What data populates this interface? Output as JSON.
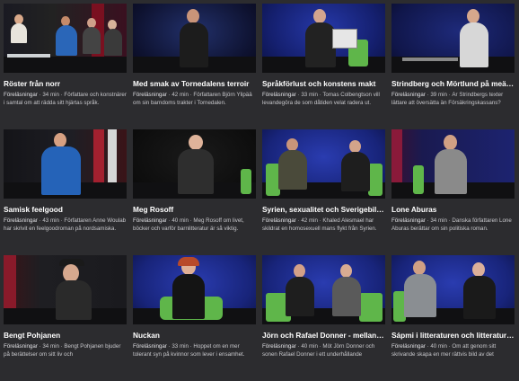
{
  "cards": [
    {
      "title": "Röster från norr",
      "category": "Föreläsningar",
      "duration": "34 min",
      "description": "Författare och konstnärer i samtal om att rädda sitt hjärtas språk."
    },
    {
      "title": "Med smak av Tornedalens terroir",
      "category": "Föreläsningar",
      "duration": "42 min",
      "description": "Författaren Björn Ylipää om sin barndoms trakter i Tornedalen."
    },
    {
      "title": "Språkförlust och konstens makt",
      "category": "Föreläsningar",
      "duration": "33 min",
      "description": "Tomas Colbengtson vill levandegöra de som dåtiden velat radera ut."
    },
    {
      "title": "Strindberg och Mörtlund på meänkieli",
      "category": "Föreläsningar",
      "duration": "39 min",
      "description": "Är Strindbergs texter lättare att översätta än Försäkringskassans?"
    },
    {
      "title": "Samisk feelgood",
      "category": "Föreläsningar",
      "duration": "43 min",
      "description": "Författaren Anne Woulab har skrivit en feelgoodroman på nordsamiska."
    },
    {
      "title": "Meg Rosoff",
      "category": "Föreläsningar",
      "duration": "40 min",
      "description": "Meg Rosoff om livet, böcker och varför barnlitteratur är så viktig."
    },
    {
      "title": "Syrien, sexualitet och Sverigebilder",
      "category": "Föreläsningar",
      "duration": "42 min",
      "description": "Khaled Alesmael har skildrat en homosexuell mans flykt från Syrien."
    },
    {
      "title": "Lone Aburas",
      "category": "Föreläsningar",
      "duration": "34 min",
      "description": "Danska författaren Lone Aburas berättar om sin politiska roman."
    },
    {
      "title": "Bengt Pohjanen",
      "category": "Föreläsningar",
      "duration": "34 min",
      "description": "Bengt Pohjanen bjuder på berättelser om sitt liv och"
    },
    {
      "title": "Nuckan",
      "category": "Föreläsningar",
      "duration": "33 min",
      "description": "Hoppet om en mer tolerant syn på kvinnor som lever i ensamhet."
    },
    {
      "title": "Jörn och Rafael Donner - mellan två språk",
      "category": "Föreläsningar",
      "duration": "40 min",
      "description": "Möt Jörn Donner och sonen Rafael Donner i ett underhållande"
    },
    {
      "title": "Sápmi i litteraturen och litteraturen i Sápmi",
      "category": "Föreläsningar",
      "duration": "40 min",
      "description": "Om att genom sitt skrivande skapa en mer rättvis bild av det"
    }
  ],
  "separator": " · ",
  "colors": {
    "accent": "#c0283a",
    "stage_blue": "#1a2a8c",
    "chair_green": "#5fb64a"
  }
}
